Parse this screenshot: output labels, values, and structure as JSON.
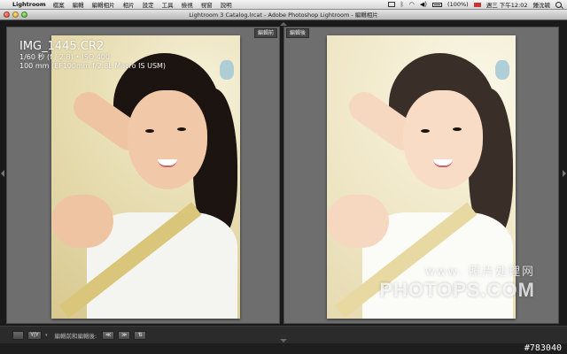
{
  "menubar": {
    "apple_icon": "apple-icon",
    "app_name": "Lightroom",
    "items": [
      "檔案",
      "編輯",
      "編輯相片",
      "相片",
      "設定",
      "工具",
      "檢視",
      "視窗",
      "說明"
    ],
    "battery": "(100%)",
    "clock": "週三 下午12:02",
    "user": "鍾沈毓"
  },
  "window": {
    "title": "Lightroom 3 Catalog.lrcat - Adobe Photoshop Lightroom - 編輯相片"
  },
  "compare": {
    "before_label": "編輯前",
    "after_label": "編輯後"
  },
  "photo_info": {
    "filename": "IMG_1445.CR2",
    "exposure": "1/60 秒 (f / 2.8) • ISO 400",
    "lens": "100 mm (EF100mm f/2.8L Macro IS USM)"
  },
  "watermark": {
    "top": "www. 照片处理网",
    "main": "PHOTOPS.COM"
  },
  "toolbar": {
    "yy_label": "Y|Y",
    "caret": "▾",
    "compare_label": "編輯前和編輯後:",
    "copy_before_to_after": "≪",
    "copy_after_to_before": "≫",
    "swap": "⇅"
  },
  "image_id": "#783040"
}
